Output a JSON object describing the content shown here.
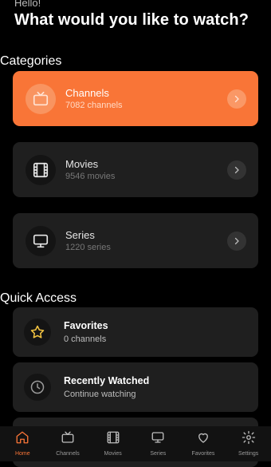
{
  "header": {
    "greeting": "Hello!",
    "headline": "What would you like to watch?"
  },
  "sections": {
    "categories": "Categories",
    "quick_access": "Quick Access"
  },
  "categories": [
    {
      "title": "Channels",
      "subtitle": "7082 channels",
      "icon": "tv-icon",
      "active": true
    },
    {
      "title": "Movies",
      "subtitle": "9546 movies",
      "icon": "film-icon",
      "active": false
    },
    {
      "title": "Series",
      "subtitle": "1220 series",
      "icon": "monitor-icon",
      "active": false
    }
  ],
  "quick_access": [
    {
      "title": "Favorites",
      "subtitle": "0 channels",
      "icon": "star-icon"
    },
    {
      "title": "Recently Watched",
      "subtitle": "Continue watching",
      "icon": "clock-icon"
    }
  ],
  "nav": [
    {
      "label": "Home",
      "icon": "home-icon",
      "active": true
    },
    {
      "label": "Channels",
      "icon": "tv-icon",
      "active": false
    },
    {
      "label": "Movies",
      "icon": "film-icon",
      "active": false
    },
    {
      "label": "Series",
      "icon": "monitor-icon",
      "active": false
    },
    {
      "label": "Favorites",
      "icon": "heart-icon",
      "active": false
    },
    {
      "label": "Settings",
      "icon": "gear-icon",
      "active": false
    }
  ],
  "colors": {
    "accent": "#f97537",
    "background": "#000000",
    "card": "#1f1f1f",
    "star": "#f5c542"
  }
}
